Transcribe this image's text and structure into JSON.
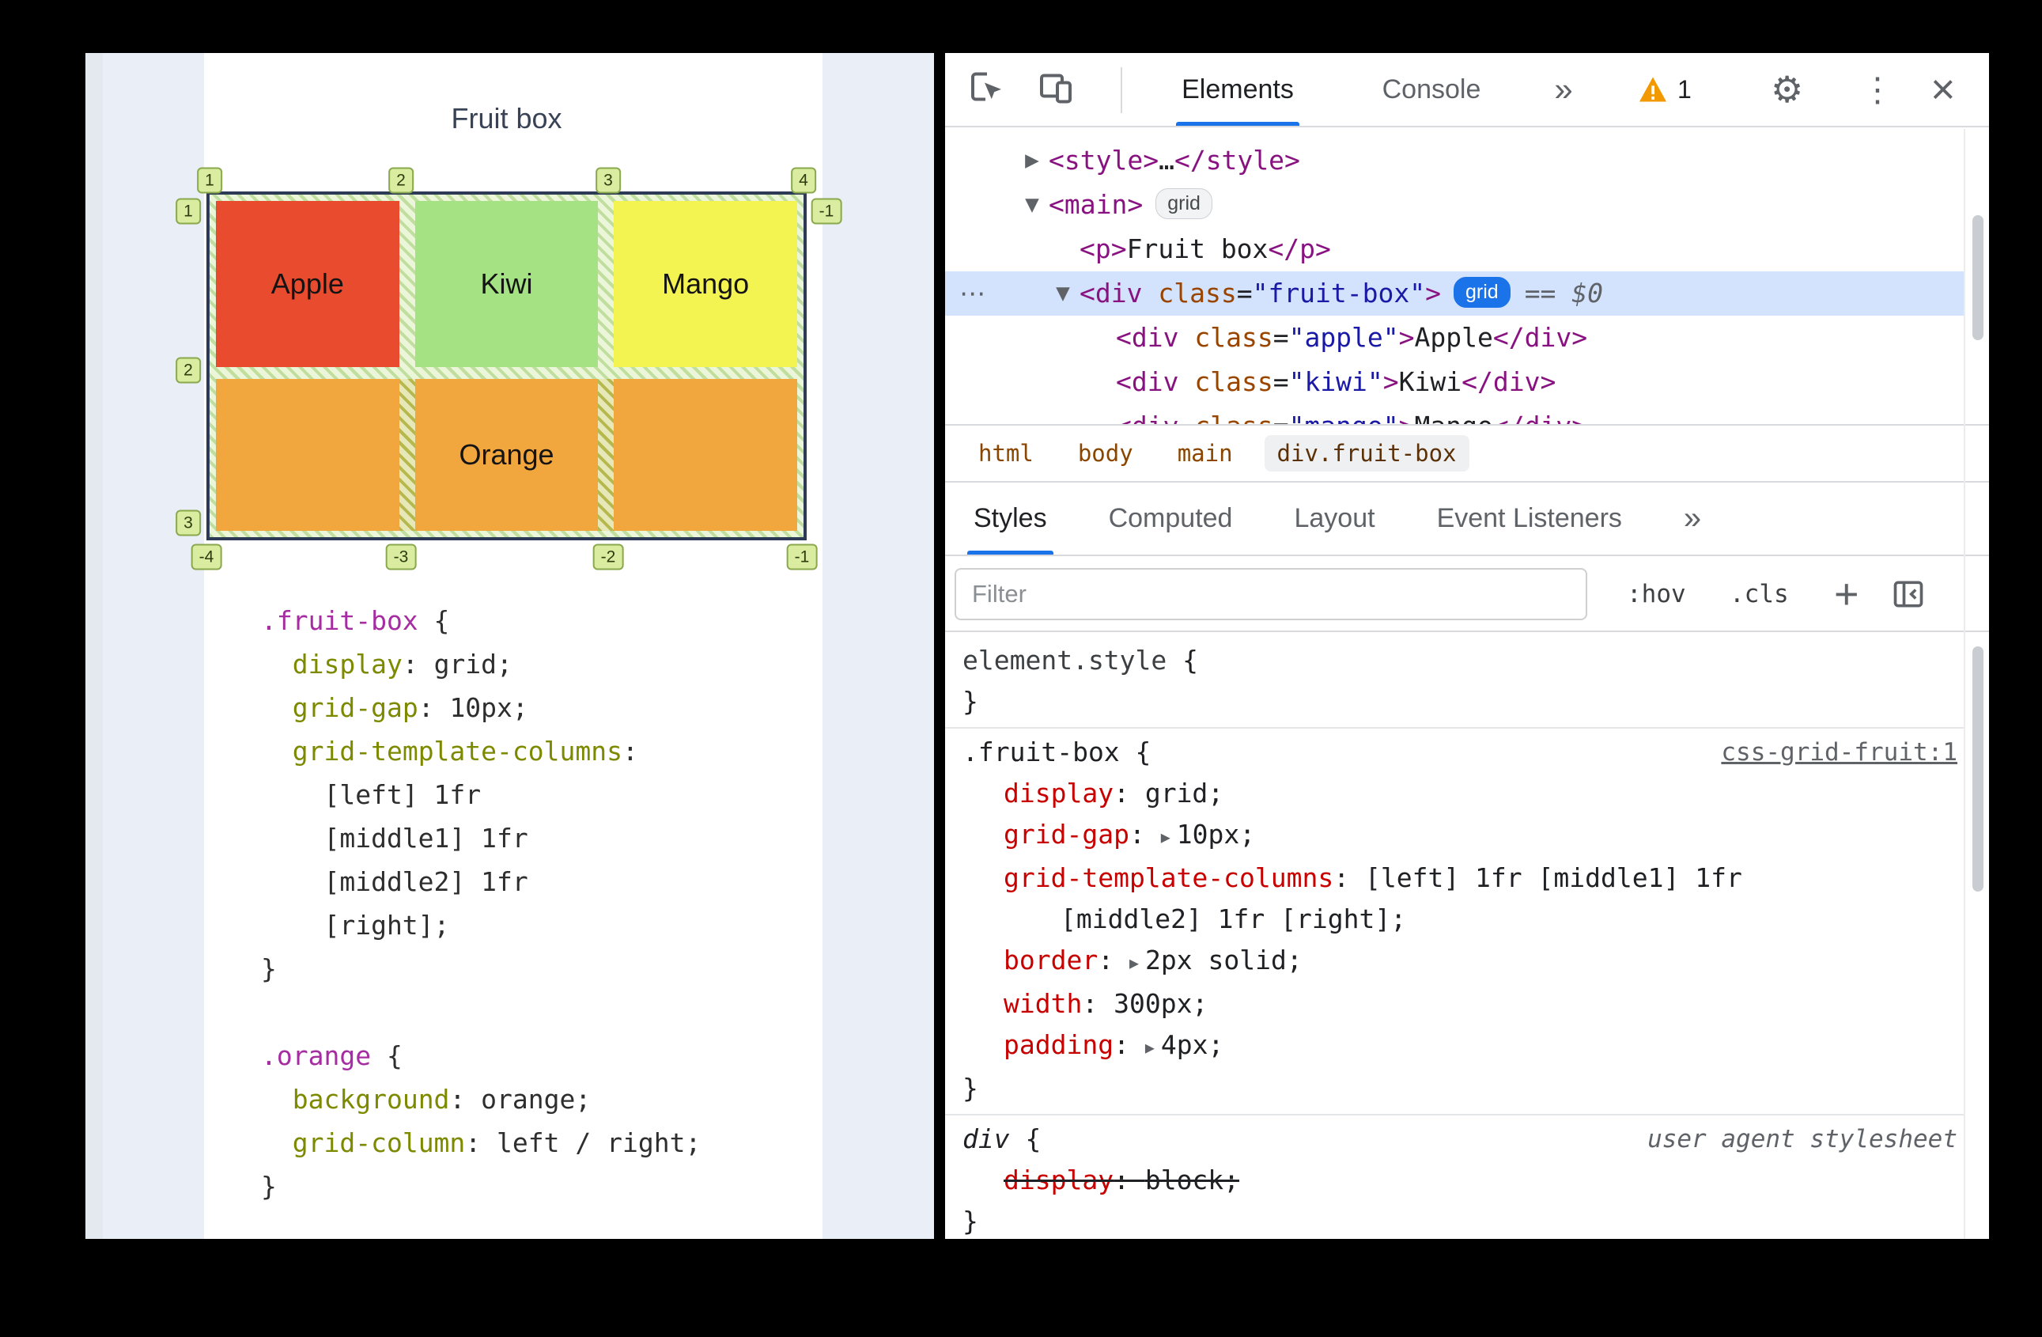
{
  "colors": {
    "accent": "#1a73e8",
    "warning": "#f29900",
    "selection": "#d3e3fd"
  },
  "icons": {
    "gear": "⚙",
    "kebab-menu": "⋮",
    "close": "×",
    "more-tabs": "»",
    "tree-collapsed": "▶",
    "tree-expanded": "▼",
    "disclosure": "▸",
    "overflow-dots": "⋯",
    "add-rule": "+"
  },
  "page": {
    "title": "Fruit box",
    "grid": {
      "cells": [
        {
          "name": "apple",
          "label": "Apple",
          "color": "#e94b2f"
        },
        {
          "name": "kiwi",
          "label": "Kiwi",
          "color": "#a5e283"
        },
        {
          "name": "mango",
          "label": "Mango",
          "color": "#f3f351"
        },
        {
          "name": "orange",
          "label": "Orange",
          "color": "#f2a73e"
        }
      ],
      "line_labels": {
        "top": [
          "1",
          "2",
          "3",
          "4"
        ],
        "left": [
          "1",
          "2",
          "3"
        ],
        "right": [
          "-1"
        ],
        "bottom": [
          "-4",
          "-3",
          "-2",
          "-1"
        ]
      }
    },
    "code_lines": [
      [
        [
          "sel",
          ".fruit-box"
        ],
        [
          "pln",
          " {"
        ]
      ],
      [
        [
          "pln",
          "  "
        ],
        [
          "prop",
          "display"
        ],
        [
          "pln",
          ": grid;"
        ]
      ],
      [
        [
          "pln",
          "  "
        ],
        [
          "prop",
          "grid-gap"
        ],
        [
          "pln",
          ": 10px;"
        ]
      ],
      [
        [
          "pln",
          "  "
        ],
        [
          "prop",
          "grid-template-columns"
        ],
        [
          "pln",
          ":"
        ]
      ],
      [
        [
          "pln",
          "    [left] 1fr"
        ]
      ],
      [
        [
          "pln",
          "    [middle1] 1fr"
        ]
      ],
      [
        [
          "pln",
          "    [middle2] 1fr"
        ]
      ],
      [
        [
          "pln",
          "    [right];"
        ]
      ],
      [
        [
          "pln",
          "}"
        ]
      ],
      [],
      [
        [
          "sel",
          ".orange"
        ],
        [
          "pln",
          " {"
        ]
      ],
      [
        [
          "pln",
          "  "
        ],
        [
          "prop",
          "background"
        ],
        [
          "pln",
          ": orange;"
        ]
      ],
      [
        [
          "pln",
          "  "
        ],
        [
          "prop",
          "grid-column"
        ],
        [
          "pln",
          ": left / right;"
        ]
      ],
      [
        [
          "pln",
          "}"
        ]
      ]
    ]
  },
  "devtools": {
    "toolbar": {
      "tabs": [
        {
          "label": "Elements",
          "active": true
        },
        {
          "label": "Console",
          "active": false
        }
      ],
      "warning_count": "1"
    },
    "dom_tree": {
      "rows": [
        {
          "depth": 0,
          "arrow": "collapsed",
          "tokens": [
            [
              "tag",
              "<style>"
            ],
            [
              "txt",
              "…"
            ],
            [
              "tag",
              "</style>"
            ]
          ]
        },
        {
          "depth": 0,
          "arrow": "expanded",
          "tokens": [
            [
              "tag",
              "<main>"
            ]
          ],
          "badge": {
            "style": "gray",
            "label": "grid"
          }
        },
        {
          "depth": 1,
          "tokens": [
            [
              "tag",
              "<p>"
            ],
            [
              "txt",
              "Fruit box"
            ],
            [
              "tag",
              "</p>"
            ]
          ]
        },
        {
          "depth": 1,
          "arrow": "expanded",
          "selected": true,
          "dots": true,
          "tokens": [
            [
              "tag",
              "<div"
            ],
            [
              "attr",
              " class"
            ],
            [
              "pun",
              "="
            ],
            [
              "val",
              "\"fruit-box\""
            ],
            [
              "tag",
              ">"
            ]
          ],
          "badge": {
            "style": "blue",
            "label": "grid"
          },
          "suffix": "== $0"
        },
        {
          "depth": 2,
          "tokens": [
            [
              "tag",
              "<div"
            ],
            [
              "attr",
              " class"
            ],
            [
              "pun",
              "="
            ],
            [
              "val",
              "\"apple\""
            ],
            [
              "tag",
              ">"
            ],
            [
              "txt",
              "Apple"
            ],
            [
              "tag",
              "</div>"
            ]
          ]
        },
        {
          "depth": 2,
          "tokens": [
            [
              "tag",
              "<div"
            ],
            [
              "attr",
              " class"
            ],
            [
              "pun",
              "="
            ],
            [
              "val",
              "\"kiwi\""
            ],
            [
              "tag",
              ">"
            ],
            [
              "txt",
              "Kiwi"
            ],
            [
              "tag",
              "</div>"
            ]
          ]
        },
        {
          "depth": 2,
          "tokens": [
            [
              "tag",
              "<div"
            ],
            [
              "attr",
              " class"
            ],
            [
              "pun",
              "="
            ],
            [
              "val",
              "\"mango\""
            ],
            [
              "tag",
              ">"
            ],
            [
              "txt",
              "Mango"
            ],
            [
              "tag",
              "</div>"
            ]
          ]
        }
      ]
    },
    "breadcrumbs": [
      {
        "label": "html"
      },
      {
        "label": "body"
      },
      {
        "label": "main"
      },
      {
        "label": "div.fruit-box",
        "selected": true
      }
    ],
    "sidebar_tabs": [
      {
        "label": "Styles",
        "active": true
      },
      {
        "label": "Computed"
      },
      {
        "label": "Layout"
      },
      {
        "label": "Event Listeners"
      }
    ],
    "filter": {
      "placeholder": "Filter",
      "hov": ":hov",
      "cls": ".cls"
    },
    "styles_rules": [
      {
        "selector": "element.style",
        "selector_class": "gray",
        "declarations": []
      },
      {
        "selector": ".fruit-box",
        "link": "css-grid-fruit:1",
        "declarations": [
          {
            "name": "display",
            "value": "grid;"
          },
          {
            "name": "grid-gap",
            "arrow": true,
            "value": "10px;"
          },
          {
            "name": "grid-template-columns",
            "value": "[left] 1fr [middle1] 1fr",
            "value2": "[middle2] 1fr [right];"
          },
          {
            "name": "border",
            "arrow": true,
            "value": "2px solid;"
          },
          {
            "name": "width",
            "value": "300px;"
          },
          {
            "name": "padding",
            "arrow": true,
            "value": "4px;"
          }
        ]
      },
      {
        "selector": "div",
        "selector_italic": true,
        "link": "user agent stylesheet",
        "link_plain": true,
        "declarations": [
          {
            "name": "display",
            "value": "block;",
            "struck": true
          }
        ]
      }
    ]
  }
}
